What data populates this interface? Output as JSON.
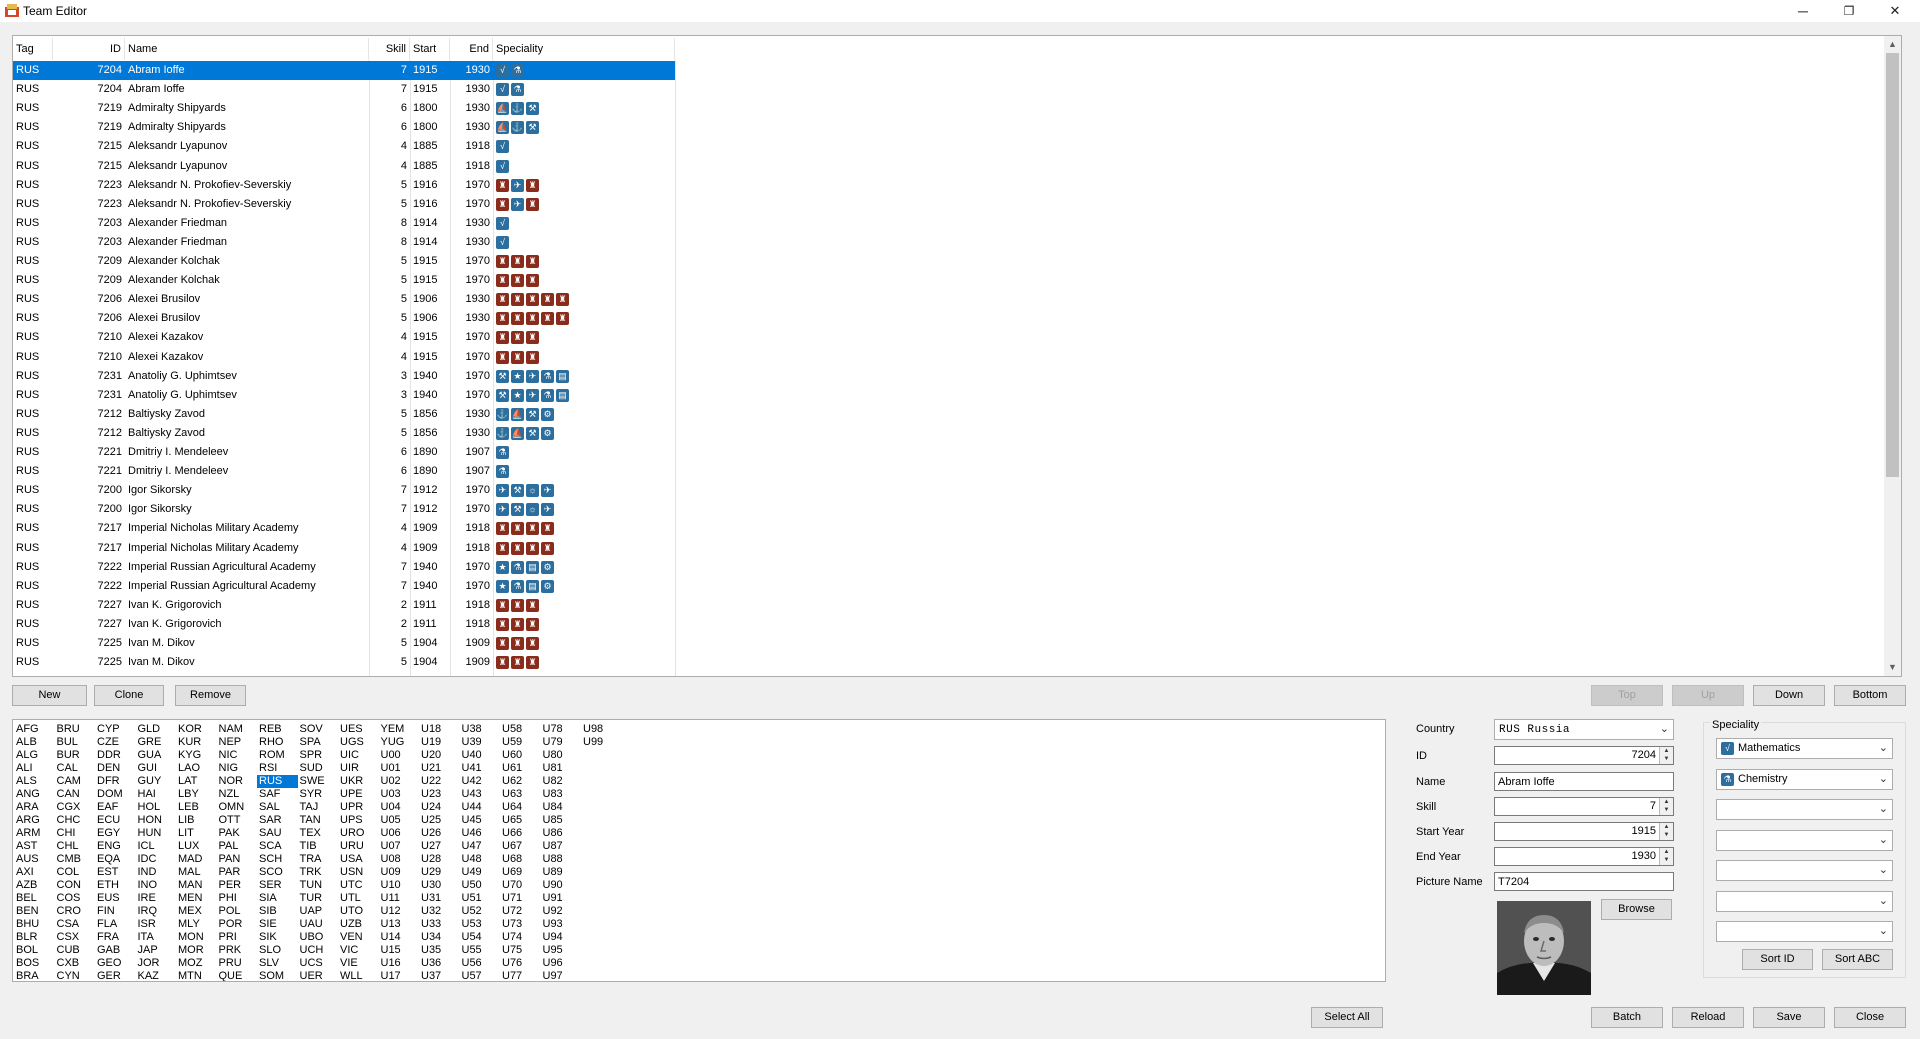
{
  "window": {
    "title": "Team Editor",
    "minimize": "─",
    "restore": "❐",
    "close": "✕"
  },
  "grid": {
    "columns": [
      "Tag",
      "ID",
      "Name",
      "Skill",
      "Start",
      "End",
      "Speciality"
    ],
    "rows": [
      {
        "tag": "RUS",
        "id": "7204",
        "name": "Abram Ioffe",
        "skill": "7",
        "start": "1915",
        "end": "1930",
        "icons": [
          "math",
          "chem"
        ],
        "selected": true
      },
      {
        "tag": "RUS",
        "id": "7204",
        "name": "Abram Ioffe",
        "skill": "7",
        "start": "1915",
        "end": "1930",
        "icons": [
          "math",
          "chem"
        ]
      },
      {
        "tag": "RUS",
        "id": "7219",
        "name": "Admiralty Shipyards",
        "skill": "6",
        "start": "1800",
        "end": "1930",
        "icons": [
          "naval",
          "anchor",
          "tool"
        ]
      },
      {
        "tag": "RUS",
        "id": "7219",
        "name": "Admiralty Shipyards",
        "skill": "6",
        "start": "1800",
        "end": "1930",
        "icons": [
          "naval",
          "anchor",
          "tool"
        ]
      },
      {
        "tag": "RUS",
        "id": "7215",
        "name": "Aleksandr Lyapunov",
        "skill": "4",
        "start": "1885",
        "end": "1918",
        "icons": [
          "math"
        ]
      },
      {
        "tag": "RUS",
        "id": "7215",
        "name": "Aleksandr Lyapunov",
        "skill": "4",
        "start": "1885",
        "end": "1918",
        "icons": [
          "math"
        ]
      },
      {
        "tag": "RUS",
        "id": "7223",
        "name": "Aleksandr N. Prokofiev-Severskiy",
        "skill": "5",
        "start": "1916",
        "end": "1970",
        "icons": [
          "land",
          "air",
          "land"
        ]
      },
      {
        "tag": "RUS",
        "id": "7223",
        "name": "Aleksandr N. Prokofiev-Severskiy",
        "skill": "5",
        "start": "1916",
        "end": "1970",
        "icons": [
          "land",
          "air",
          "land"
        ]
      },
      {
        "tag": "RUS",
        "id": "7203",
        "name": "Alexander Friedman",
        "skill": "8",
        "start": "1914",
        "end": "1930",
        "icons": [
          "math"
        ]
      },
      {
        "tag": "RUS",
        "id": "7203",
        "name": "Alexander Friedman",
        "skill": "8",
        "start": "1914",
        "end": "1930",
        "icons": [
          "math"
        ]
      },
      {
        "tag": "RUS",
        "id": "7209",
        "name": "Alexander Kolchak",
        "skill": "5",
        "start": "1915",
        "end": "1970",
        "icons": [
          "land",
          "land",
          "land"
        ]
      },
      {
        "tag": "RUS",
        "id": "7209",
        "name": "Alexander Kolchak",
        "skill": "5",
        "start": "1915",
        "end": "1970",
        "icons": [
          "land",
          "land",
          "land"
        ]
      },
      {
        "tag": "RUS",
        "id": "7206",
        "name": "Alexei Brusilov",
        "skill": "5",
        "start": "1906",
        "end": "1930",
        "icons": [
          "land",
          "land",
          "land",
          "land",
          "land"
        ]
      },
      {
        "tag": "RUS",
        "id": "7206",
        "name": "Alexei Brusilov",
        "skill": "5",
        "start": "1906",
        "end": "1930",
        "icons": [
          "land",
          "land",
          "land",
          "land",
          "land"
        ]
      },
      {
        "tag": "RUS",
        "id": "7210",
        "name": "Alexei Kazakov",
        "skill": "4",
        "start": "1915",
        "end": "1970",
        "icons": [
          "land",
          "land",
          "land"
        ]
      },
      {
        "tag": "RUS",
        "id": "7210",
        "name": "Alexei Kazakov",
        "skill": "4",
        "start": "1915",
        "end": "1970",
        "icons": [
          "land",
          "land",
          "land"
        ]
      },
      {
        "tag": "RUS",
        "id": "7231",
        "name": "Anatoliy G. Uphimtsev",
        "skill": "3",
        "start": "1940",
        "end": "1970",
        "icons": [
          "tool",
          "star",
          "air",
          "chem",
          "doc"
        ]
      },
      {
        "tag": "RUS",
        "id": "7231",
        "name": "Anatoliy G. Uphimtsev",
        "skill": "3",
        "start": "1940",
        "end": "1970",
        "icons": [
          "tool",
          "star",
          "air",
          "chem",
          "doc"
        ]
      },
      {
        "tag": "RUS",
        "id": "7212",
        "name": "Baltiysky Zavod",
        "skill": "5",
        "start": "1856",
        "end": "1930",
        "icons": [
          "anchor",
          "naval",
          "tool",
          "gear"
        ]
      },
      {
        "tag": "RUS",
        "id": "7212",
        "name": "Baltiysky Zavod",
        "skill": "5",
        "start": "1856",
        "end": "1930",
        "icons": [
          "anchor",
          "naval",
          "tool",
          "gear"
        ]
      },
      {
        "tag": "RUS",
        "id": "7221",
        "name": "Dmitriy I. Mendeleev",
        "skill": "6",
        "start": "1890",
        "end": "1907",
        "icons": [
          "chem"
        ]
      },
      {
        "tag": "RUS",
        "id": "7221",
        "name": "Dmitriy I. Mendeleev",
        "skill": "6",
        "start": "1890",
        "end": "1907",
        "icons": [
          "chem"
        ]
      },
      {
        "tag": "RUS",
        "id": "7200",
        "name": "Igor Sikorsky",
        "skill": "7",
        "start": "1912",
        "end": "1970",
        "icons": [
          "air",
          "tool",
          "bulb",
          "air"
        ]
      },
      {
        "tag": "RUS",
        "id": "7200",
        "name": "Igor Sikorsky",
        "skill": "7",
        "start": "1912",
        "end": "1970",
        "icons": [
          "air",
          "tool",
          "bulb",
          "air"
        ]
      },
      {
        "tag": "RUS",
        "id": "7217",
        "name": "Imperial Nicholas Military Academy",
        "skill": "4",
        "start": "1909",
        "end": "1918",
        "icons": [
          "land",
          "land",
          "land",
          "land"
        ]
      },
      {
        "tag": "RUS",
        "id": "7217",
        "name": "Imperial Nicholas Military Academy",
        "skill": "4",
        "start": "1909",
        "end": "1918",
        "icons": [
          "land",
          "land",
          "land",
          "land"
        ]
      },
      {
        "tag": "RUS",
        "id": "7222",
        "name": "Imperial Russian Agricultural Academy",
        "skill": "7",
        "start": "1940",
        "end": "1970",
        "icons": [
          "star",
          "chem",
          "doc",
          "gear"
        ]
      },
      {
        "tag": "RUS",
        "id": "7222",
        "name": "Imperial Russian Agricultural Academy",
        "skill": "7",
        "start": "1940",
        "end": "1970",
        "icons": [
          "star",
          "chem",
          "doc",
          "gear"
        ]
      },
      {
        "tag": "RUS",
        "id": "7227",
        "name": "Ivan K. Grigorovich",
        "skill": "2",
        "start": "1911",
        "end": "1918",
        "icons": [
          "land",
          "land",
          "land"
        ]
      },
      {
        "tag": "RUS",
        "id": "7227",
        "name": "Ivan K. Grigorovich",
        "skill": "2",
        "start": "1911",
        "end": "1918",
        "icons": [
          "land",
          "land",
          "land"
        ]
      },
      {
        "tag": "RUS",
        "id": "7225",
        "name": "Ivan M. Dikov",
        "skill": "5",
        "start": "1904",
        "end": "1909",
        "icons": [
          "land",
          "land",
          "land"
        ]
      },
      {
        "tag": "RUS",
        "id": "7225",
        "name": "Ivan M. Dikov",
        "skill": "5",
        "start": "1904",
        "end": "1909",
        "icons": [
          "land",
          "land",
          "land"
        ]
      }
    ]
  },
  "grid_buttons": {
    "new": "New",
    "clone": "Clone",
    "remove": "Remove",
    "top": "Top",
    "up": "Up",
    "down": "Down",
    "bottom": "Bottom"
  },
  "country_columns": [
    [
      "AFG",
      "ALB",
      "ALG",
      "ALI",
      "ALS",
      "ANG",
      "ARA",
      "ARG",
      "ARM",
      "AST",
      "AUS",
      "AXI",
      "AZB",
      "BEL",
      "BEN",
      "BHU",
      "BLR",
      "BOL",
      "BOS",
      "BRA"
    ],
    [
      "BRU",
      "BUL",
      "BUR",
      "CAL",
      "CAM",
      "CAN",
      "CGX",
      "CHC",
      "CHI",
      "CHL",
      "CMB",
      "COL",
      "CON",
      "COS",
      "CRO",
      "CSA",
      "CSX",
      "CUB",
      "CXB",
      "CYN"
    ],
    [
      "CYP",
      "CZE",
      "DDR",
      "DEN",
      "DFR",
      "DOM",
      "EAF",
      "ECU",
      "EGY",
      "ENG",
      "EQA",
      "EST",
      "ETH",
      "EUS",
      "FIN",
      "FLA",
      "FRA",
      "GAB",
      "GEO",
      "GER"
    ],
    [
      "GLD",
      "GRE",
      "GUA",
      "GUI",
      "GUY",
      "HAI",
      "HOL",
      "HON",
      "HUN",
      "ICL",
      "IDC",
      "IND",
      "INO",
      "IRE",
      "IRQ",
      "ISR",
      "ITA",
      "JAP",
      "JOR",
      "KAZ"
    ],
    [
      "KOR",
      "KUR",
      "KYG",
      "LAO",
      "LAT",
      "LBY",
      "LEB",
      "LIB",
      "LIT",
      "LUX",
      "MAD",
      "MAL",
      "MAN",
      "MEN",
      "MEX",
      "MLY",
      "MON",
      "MOR",
      "MOZ",
      "MTN"
    ],
    [
      "NAM",
      "NEP",
      "NIC",
      "NIG",
      "NOR",
      "NZL",
      "OMN",
      "OTT",
      "PAK",
      "PAL",
      "PAN",
      "PAR",
      "PER",
      "PHI",
      "POL",
      "POR",
      "PRI",
      "PRK",
      "PRU",
      "QUE"
    ],
    [
      "REB",
      "RHO",
      "ROM",
      "RSI",
      "RUS",
      "SAF",
      "SAL",
      "SAR",
      "SAU",
      "SCA",
      "SCH",
      "SCO",
      "SER",
      "SIA",
      "SIB",
      "SIE",
      "SIK",
      "SLO",
      "SLV",
      "SOM"
    ],
    [
      "SOV",
      "SPA",
      "SPR",
      "SUD",
      "SWE",
      "SYR",
      "TAJ",
      "TAN",
      "TEX",
      "TIB",
      "TRA",
      "TRK",
      "TUN",
      "TUR",
      "UAP",
      "UAU",
      "UBO",
      "UCH",
      "UCS",
      "UER"
    ],
    [
      "UES",
      "UGS",
      "UIC",
      "UIR",
      "UKR",
      "UPE",
      "UPR",
      "UPS",
      "URO",
      "URU",
      "USA",
      "USN",
      "UTC",
      "UTL",
      "UTO",
      "UZB",
      "VEN",
      "VIC",
      "VIE",
      "WLL"
    ],
    [
      "YEM",
      "YUG",
      "U00",
      "U01",
      "U02",
      "U03",
      "U04",
      "U05",
      "U06",
      "U07",
      "U08",
      "U09",
      "U10",
      "U11",
      "U12",
      "U13",
      "U14",
      "U15",
      "U16",
      "U17"
    ],
    [
      "U18",
      "U19",
      "U20",
      "U21",
      "U22",
      "U23",
      "U24",
      "U25",
      "U26",
      "U27",
      "U28",
      "U29",
      "U30",
      "U31",
      "U32",
      "U33",
      "U34",
      "U35",
      "U36",
      "U37"
    ],
    [
      "U38",
      "U39",
      "U40",
      "U41",
      "U42",
      "U43",
      "U44",
      "U45",
      "U46",
      "U47",
      "U48",
      "U49",
      "U50",
      "U51",
      "U52",
      "U53",
      "U54",
      "U55",
      "U56",
      "U57"
    ],
    [
      "U58",
      "U59",
      "U60",
      "U61",
      "U62",
      "U63",
      "U64",
      "U65",
      "U66",
      "U67",
      "U68",
      "U69",
      "U70",
      "U71",
      "U72",
      "U73",
      "U74",
      "U75",
      "U76",
      "U77"
    ],
    [
      "U78",
      "U79",
      "U80",
      "U81",
      "U82",
      "U83",
      "U84",
      "U85",
      "U86",
      "U87",
      "U88",
      "U89",
      "U90",
      "U91",
      "U92",
      "U93",
      "U94",
      "U95",
      "U96",
      "U97"
    ],
    [
      "U98",
      "U99"
    ]
  ],
  "selected_country": "RUS",
  "details": {
    "country_label": "Country",
    "country_value": "RUS Russia",
    "id_label": "ID",
    "id_value": "7204",
    "name_label": "Name",
    "name_value": "Abram Ioffe",
    "skill_label": "Skill",
    "skill_value": "7",
    "start_label": "Start Year",
    "start_value": "1915",
    "end_label": "End Year",
    "end_value": "1930",
    "picture_label": "Picture Name",
    "picture_value": "T7204",
    "browse": "Browse"
  },
  "speciality": {
    "legend": "Speciality",
    "slots": [
      {
        "icon": "math",
        "label": "Mathematics"
      },
      {
        "icon": "chem",
        "label": "Chemistry"
      },
      {
        "icon": "",
        "label": ""
      },
      {
        "icon": "",
        "label": ""
      },
      {
        "icon": "",
        "label": ""
      },
      {
        "icon": "",
        "label": ""
      },
      {
        "icon": "",
        "label": ""
      }
    ],
    "sort_id": "Sort ID",
    "sort_abc": "Sort ABC"
  },
  "bottom_buttons": {
    "select_all": "Select All",
    "batch": "Batch",
    "reload": "Reload",
    "save": "Save",
    "close": "Close"
  },
  "icon_colors": {
    "math": "#2c6e9e",
    "chem": "#2c6e9e",
    "naval": "#2c6e9e",
    "anchor": "#2c6e9e",
    "tool": "#2c6e9e",
    "air": "#2c6e9e",
    "star": "#2c6e9e",
    "doc": "#2c6e9e",
    "gear": "#2c6e9e",
    "bulb": "#2c6e9e",
    "land": "#8a2c1c"
  },
  "icon_glyphs": {
    "math": "√",
    "chem": "⚗",
    "naval": "⛵",
    "anchor": "⚓",
    "tool": "⚒",
    "air": "✈",
    "star": "★",
    "doc": "▤",
    "gear": "⚙",
    "bulb": "☼",
    "land": "♜"
  }
}
